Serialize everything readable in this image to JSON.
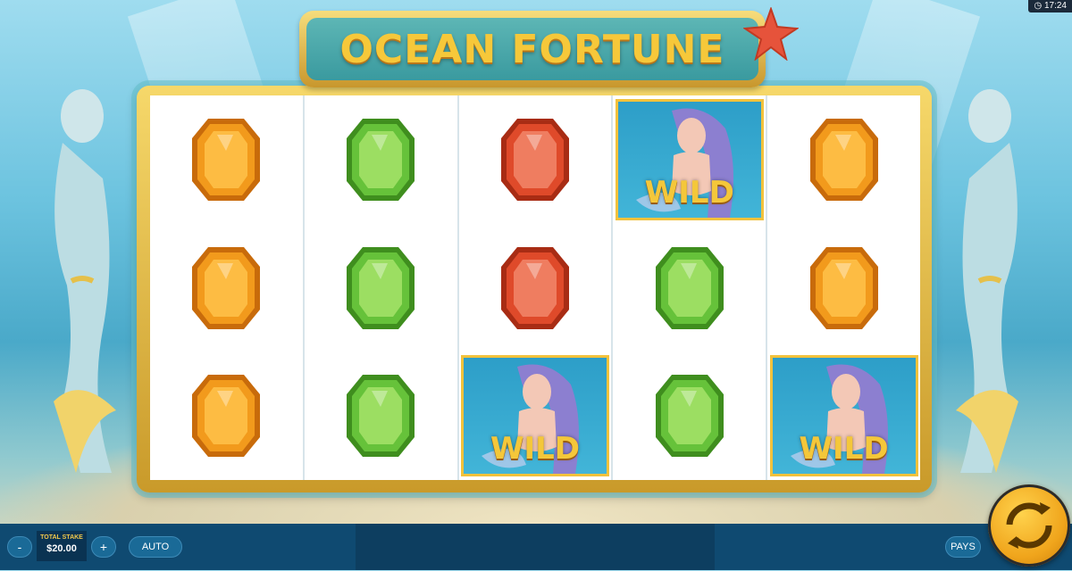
{
  "game": {
    "title": "OCEAN FORTUNE",
    "clock": "17:24"
  },
  "reels": [
    [
      "orange-gem",
      "orange-gem",
      "orange-gem"
    ],
    [
      "green-gem",
      "green-gem",
      "green-gem"
    ],
    [
      "red-gem",
      "red-gem",
      "wild"
    ],
    [
      "wild",
      "green-gem",
      "green-gem"
    ],
    [
      "orange-gem",
      "orange-gem",
      "wild"
    ]
  ],
  "symbols": {
    "wild_label": "WILD"
  },
  "colors": {
    "orange": "#f29a1c",
    "green": "#66c23a",
    "red": "#df4a2a",
    "gold": "#f2c23c"
  },
  "controls": {
    "minus": "-",
    "plus": "+",
    "stake_label": "TOTAL STAKE",
    "stake_value": "$20.00",
    "auto": "AUTO",
    "pays": "PAYS"
  }
}
